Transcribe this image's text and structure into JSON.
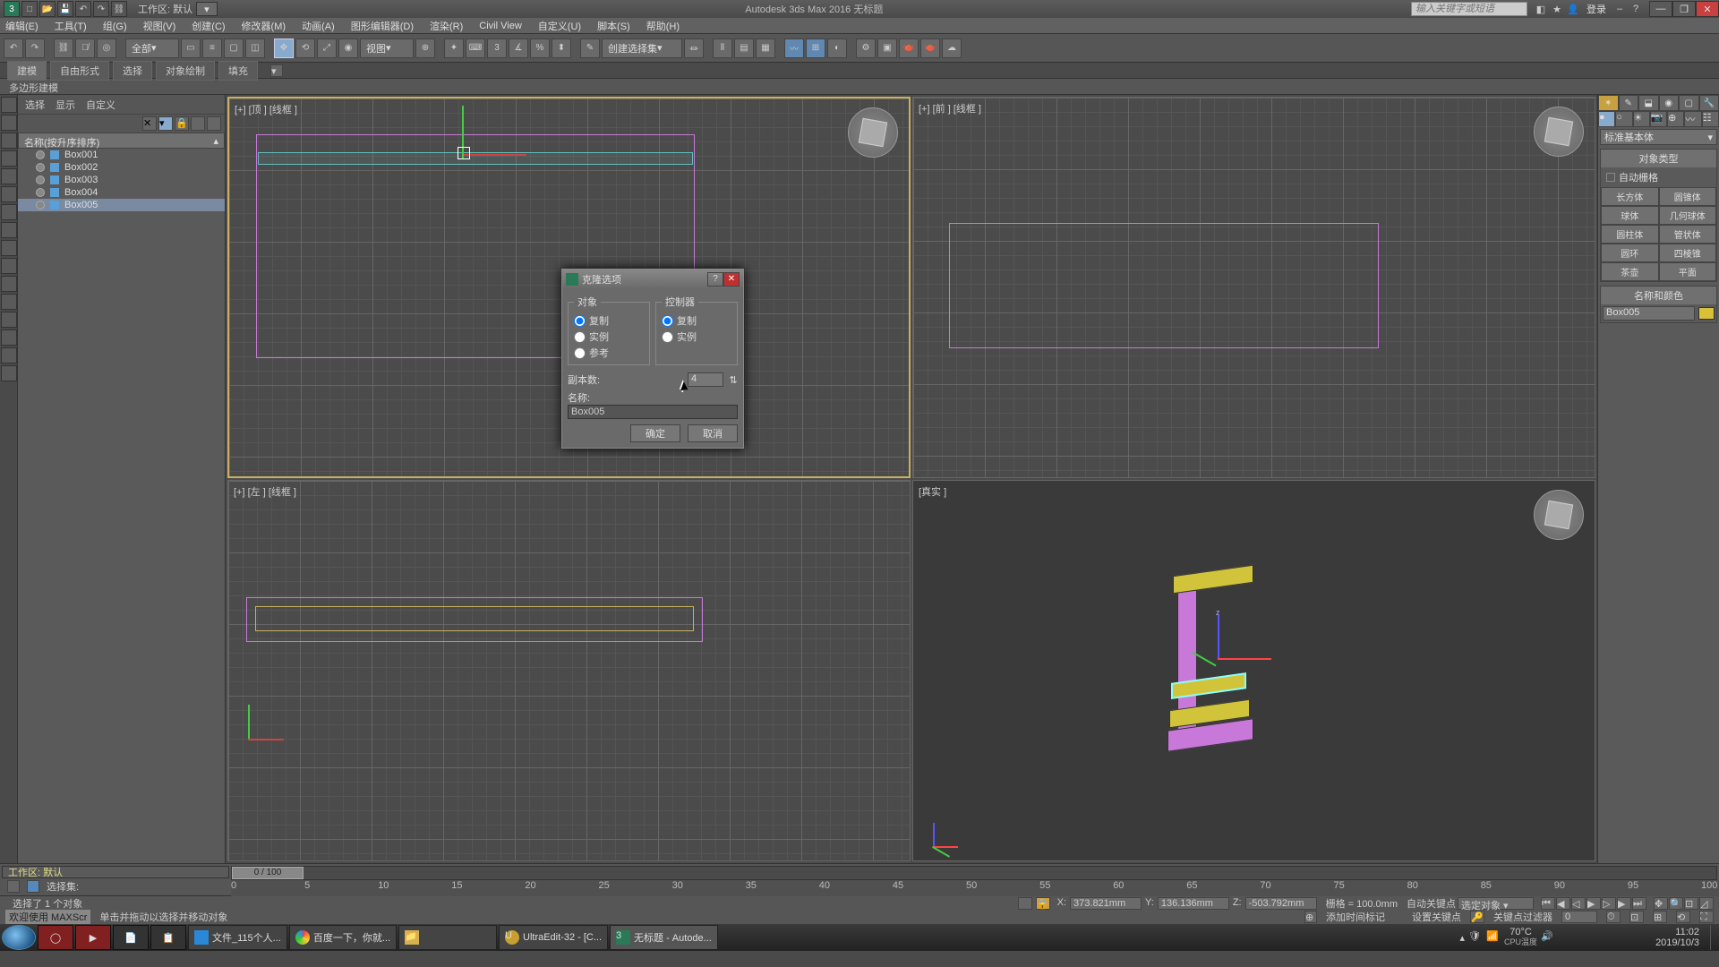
{
  "title": "Autodesk 3ds Max 2016   无标题",
  "workspace_label": "工作区: 默认",
  "search_placeholder": "输入关键字或短语",
  "login_label": "登录",
  "menus": [
    "编辑(E)",
    "工具(T)",
    "组(G)",
    "视图(V)",
    "创建(C)",
    "修改器(M)",
    "动画(A)",
    "图形编辑器(D)",
    "渲染(R)",
    "Civil View",
    "自定义(U)",
    "脚本(S)",
    "帮助(H)"
  ],
  "toolbar_dd_all": "全部",
  "toolbar_dd_view": "视图",
  "toolbar_dd_set": "创建选择集",
  "ribbon_tabs": [
    "建模",
    "自由形式",
    "选择",
    "对象绘制",
    "填充"
  ],
  "ribbon2": "多边形建模",
  "explorer_tabs": [
    "选择",
    "显示",
    "自定义"
  ],
  "explorer_header": "名称(按升序排序)",
  "scene_items": [
    "Box001",
    "Box002",
    "Box003",
    "Box004",
    "Box005"
  ],
  "selected_item_index": 4,
  "viewport_labels": {
    "top": "[+] [顶 ] [线框 ]",
    "front": "[+] [前 ] [线框 ]",
    "left": "[+] [左 ] [线框 ]",
    "persp": "[真实 ]"
  },
  "cmd": {
    "dropdown": "标准基本体",
    "section_objtype": "对象类型",
    "autogrid": "自动栅格",
    "buttons": [
      [
        "长方体",
        "圆锥体"
      ],
      [
        "球体",
        "几何球体"
      ],
      [
        "圆柱体",
        "管状体"
      ],
      [
        "圆环",
        "四棱锥"
      ],
      [
        "茶壶",
        "平面"
      ]
    ],
    "section_name": "名称和颜色",
    "name_value": "Box005"
  },
  "slider_label": "0 / 100",
  "ruler_ticks": [
    0,
    5,
    10,
    15,
    20,
    25,
    30,
    35,
    40,
    45,
    50,
    55,
    60,
    65,
    70,
    75,
    80,
    85,
    90,
    95,
    100
  ],
  "ws_line": "工作区: 默认",
  "ws_line2": "选择集:",
  "status": {
    "selected": "选择了 1 个对象",
    "welcome": "欢迎使用   MAXScr",
    "prompt": "单击并拖动以选择并移动对象",
    "x": "373.821mm",
    "y": "136.136mm",
    "z": "-503.792mm",
    "grid": "栅格 = 100.0mm",
    "autokey": "自动关键点",
    "seldd": "选定对象",
    "setkey": "设置关键点",
    "keyfilter": "关键点过滤器",
    "addtime": "添加时间标记"
  },
  "dialog": {
    "title": "克隆选项",
    "obj_legend": "对象",
    "ctrl_legend": "控制器",
    "copy": "复制",
    "instance": "实例",
    "reference": "参考",
    "copies_label": "副本数:",
    "copies_value": "4",
    "name_label": "名称:",
    "name_value": "Box005",
    "ok": "确定",
    "cancel": "取消"
  },
  "taskbar": {
    "items": [
      "文件_115个人...",
      "百度一下，你就...",
      "",
      "UltraEdit-32 - [C...",
      "无标题 - Autode..."
    ],
    "temp": "70°C",
    "cpu": "CPU温度",
    "time": "11:02",
    "date": "2019/10/3"
  }
}
